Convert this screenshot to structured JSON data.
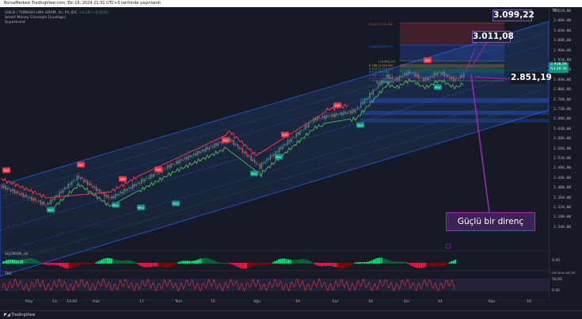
{
  "header": {
    "text": "BorsaMerkezi TradingView.com, Eki 16, 2024 21:31 UTC+3 tarihinde yayınlandı"
  },
  "legend": {
    "symbol": "GOLD / TURKISH LIRA GRAM, 4s, FX_IDC",
    "change": "+0,18 (+0,01%)",
    "line2": "Smart Money Concepts [LuxAlgo]",
    "line3": "Supertrend"
  },
  "price_axis": {
    "currency": "TRY",
    "ticks": [
      "3.120,00",
      "3.080,00",
      "3.040,00",
      "3.000,00",
      "2.960,00",
      "2.920,00",
      "2.880,00",
      "2.840,00",
      "2.800,00",
      "2.760,00",
      "2.720,00",
      "2.680,00",
      "2.640,00",
      "2.600,00",
      "2.560,00",
      "2.520,00",
      "2.480,00",
      "2.440,00",
      "2.400,00",
      "2.360,00",
      "2.320,00",
      "2.280,00",
      "2.240,00"
    ],
    "current_price": "2.938,56",
    "current_time": "03:28:30"
  },
  "fib_labels": [
    "1.618 (3.101,88)",
    "1.618 (3.009,97)",
    "1 (2.952,17)",
    "0.786 (2.933,96)",
    "0.618 (2.919,42)",
    "0.5 (2.909,50)",
    "0.382 (2.899,44)",
    "0.236 (2.887,95)",
    "0 (2.866,83)"
  ],
  "markers": {
    "sell_label": "Sell",
    "buy_label": "Buy"
  },
  "price_boxes": {
    "p1": "3.099,22",
    "p2": "3.011,08",
    "p3": "2.851,19"
  },
  "callout": {
    "text": "Güçlü bir direnç"
  },
  "sub_panes": {
    "pane1": {
      "label": "SQZMOM_LB",
      "tick": "0,00"
    },
    "pane2": {
      "label": "TKE",
      "tick_top": "-100.000.000,00",
      "tick_mid": "50,00",
      "tick_low": "0,00"
    }
  },
  "x_axis": {
    "labels": [
      "May",
      "13",
      "13:00",
      "Haz",
      "17",
      "Tem",
      "15",
      "Ağu",
      "19",
      "Eyl",
      "16",
      "Eki",
      "14",
      "Kas",
      "18"
    ]
  },
  "footer": {
    "brand": "TradingView"
  },
  "colors": {
    "background": "#161a25",
    "sell": "#f23645",
    "buy": "#089981",
    "channel": "#2962ff",
    "callout": "#9c27b0",
    "axis_text": "#b2b5be"
  }
}
